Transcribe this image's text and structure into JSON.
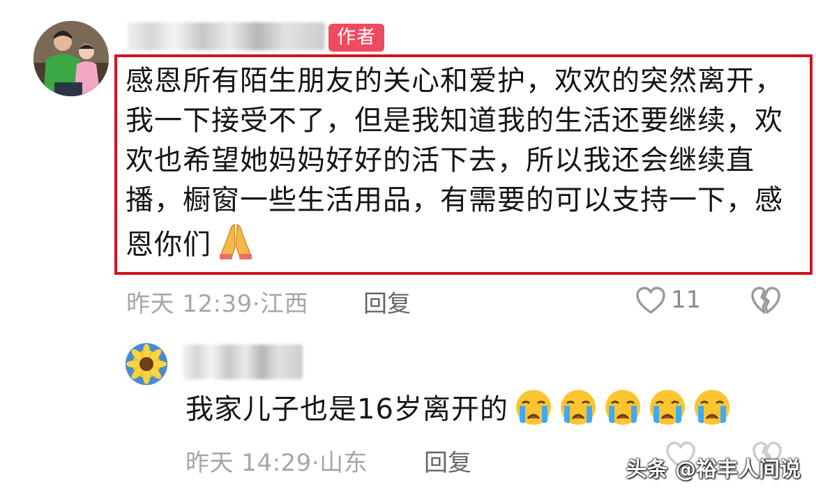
{
  "comment": {
    "author_badge": "作者",
    "text": "感恩所有陌生朋友的关心和爱护，欢欢的突然离开，我一下接受不了，但是我知道我的生活还要继续，欢欢也希望她妈妈好好的活下去，所以我还会继续直播，橱窗一些生活用品，有需要的可以支持一下，感恩你们",
    "text_emoji": "praying-hands",
    "time": "昨天 12:39",
    "location_sep": "·",
    "location": "江西",
    "reply_label": "回复",
    "like_count": "11",
    "like_icon": "heart-outline-icon",
    "dislike_icon": "broken-heart-icon",
    "highlight_color": "#d3121e",
    "badge_color": "#f04a5f"
  },
  "reply_comment": {
    "text": "我家儿子也是16岁离开的",
    "emojis": [
      "crying-face",
      "crying-face",
      "crying-face",
      "crying-face",
      "crying-face"
    ],
    "time": "昨天 14:29",
    "location_sep": "·",
    "location": "山东",
    "reply_label": "回复"
  },
  "watermark": "头条 @裕丰人间说"
}
